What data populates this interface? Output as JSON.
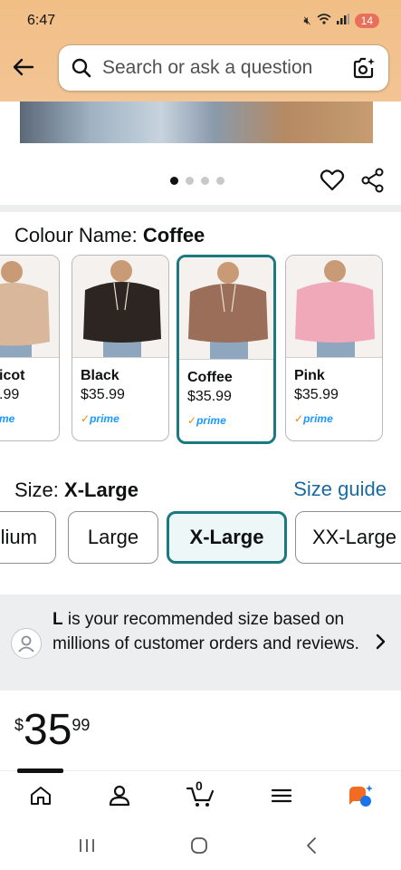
{
  "status_bar": {
    "time": "6:47",
    "battery": "14"
  },
  "search": {
    "placeholder": "Search or ask a question"
  },
  "gallery": {
    "dot_count": 4,
    "active_index": 0
  },
  "colour": {
    "label": "Colour Name:",
    "selected": "Coffee",
    "options": [
      {
        "name": "Apricot",
        "name_visible": "icot",
        "price_visible": ".99",
        "prime": "me",
        "color": "#d8b79a"
      },
      {
        "name": "Black",
        "price": "$35.99",
        "prime": "prime",
        "color": "#2c2521"
      },
      {
        "name": "Coffee",
        "price": "$35.99",
        "prime": "prime",
        "color": "#9a6e58",
        "selected": true
      },
      {
        "name": "Pink",
        "price": "$35.99",
        "prime": "prime",
        "color": "#f0a9b9"
      }
    ]
  },
  "size": {
    "label": "Size:",
    "selected": "X-Large",
    "guide": "Size guide",
    "options": [
      {
        "label": "lium"
      },
      {
        "label": "Large"
      },
      {
        "label": "X-Large",
        "selected": true
      },
      {
        "label": "XX-Large"
      }
    ]
  },
  "recommendation": {
    "size": "L",
    "text": " is your recommended size based on millions of customer orders and reviews."
  },
  "price": {
    "currency": "$",
    "whole": "35",
    "fraction": "99"
  },
  "cart": {
    "count": "0"
  },
  "colors": {
    "accent": "#1b7a80",
    "link": "#1b6aa0",
    "header": "#f1be86",
    "prime": "#1a98ff"
  }
}
